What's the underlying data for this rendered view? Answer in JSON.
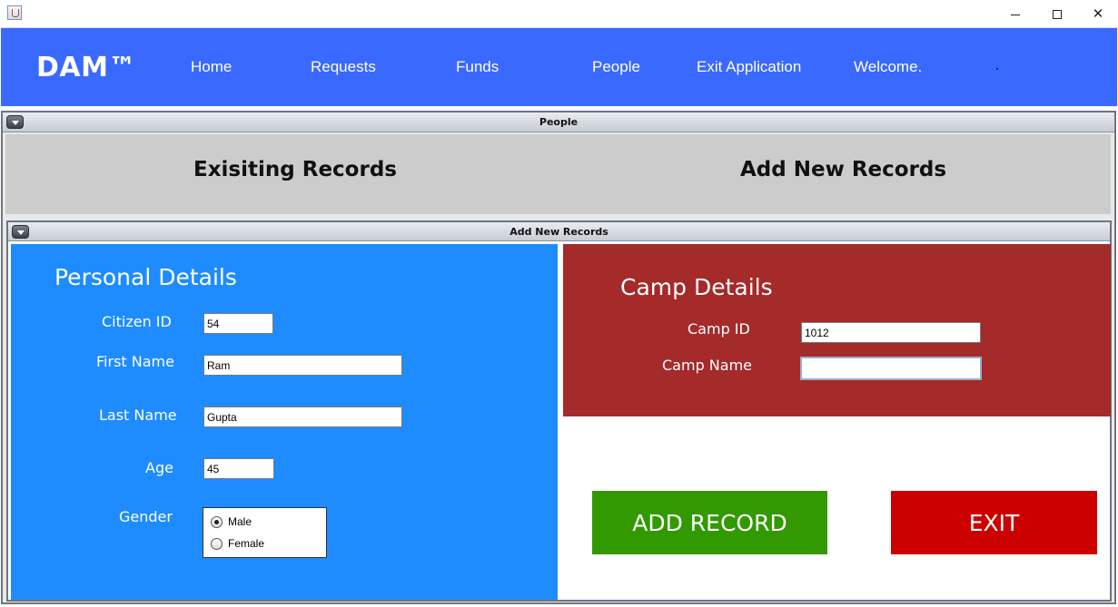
{
  "window": {
    "minimize_glyph": "",
    "maximize_glyph": "",
    "close_glyph": "✕"
  },
  "navbar": {
    "brand": "DAM™",
    "items": [
      "Home",
      "Requests",
      "Funds",
      "People",
      "Exit Application",
      "Welcome."
    ],
    "color": "#3a69ff"
  },
  "people_frame": {
    "title": "People",
    "tabs": {
      "existing": "Exisiting Records",
      "add_new": "Add New Records"
    }
  },
  "add_frame": {
    "title": "Add New Records",
    "personal": {
      "heading": "Personal Details",
      "citizen_id_label": "Citizen ID",
      "citizen_id_value": "54",
      "first_name_label": "First Name",
      "first_name_value": "Ram",
      "last_name_label": "Last Name",
      "last_name_value": "Gupta",
      "age_label": "Age",
      "age_value": "45",
      "gender_label": "Gender",
      "gender_options": [
        "Male",
        "Female"
      ],
      "gender_selected": "Male",
      "color": "#1e8cff"
    },
    "camp": {
      "heading": "Camp Details",
      "camp_id_label": "Camp ID",
      "camp_id_value": "1012",
      "camp_name_label": "Camp Name",
      "camp_name_value": "",
      "color": "#a52a2a"
    },
    "buttons": {
      "add_record": "ADD RECORD",
      "exit": "EXIT",
      "add_color": "#339900",
      "exit_color": "#cc0000"
    }
  }
}
